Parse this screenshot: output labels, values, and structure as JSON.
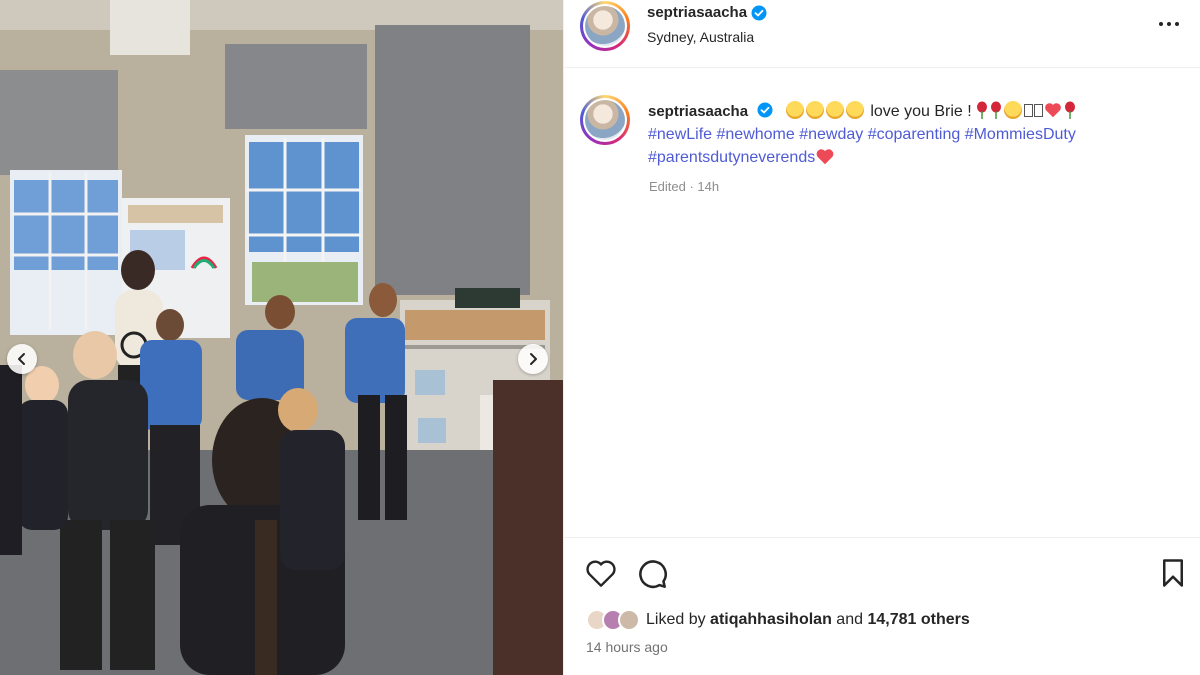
{
  "post": {
    "username": "septriasaacha",
    "location": "Sydney, Australia",
    "caption_text": "love you Brie !",
    "hashtags_line1": [
      "#newLife",
      "#newhome",
      "#newday",
      "#coparenting",
      "#MommiesDuty"
    ],
    "hashtags_line2": "#parentsdutyneverends",
    "edited": "Edited · 14h",
    "liked_by_prefix": "Liked by",
    "liked_by_user": "atiqahhasiholan",
    "liked_by_and": "and",
    "liked_by_others": "14,781 others",
    "time_ago": "14 hours ago"
  },
  "icons": {
    "more": "more-horizontal-icon",
    "like": "heart-outline-icon",
    "comment": "comment-bubble-icon",
    "save": "bookmark-icon",
    "verified": "verified-badge-icon",
    "prev": "chevron-left-icon",
    "next": "chevron-right-icon"
  },
  "colors": {
    "verified": "#0095f6",
    "hashtag": "#4f5bd5",
    "heart": "#ed4956",
    "muted": "#8e8e8e"
  }
}
